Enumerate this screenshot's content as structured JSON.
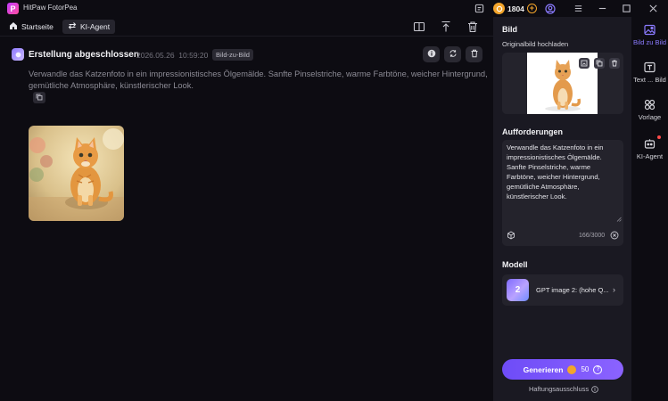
{
  "app": {
    "title": "HitPaw FotorPea",
    "logo_letter": "P",
    "accent": "#7b5cff",
    "coin_color": "#f3a52b"
  },
  "titlebar": {
    "coins": "1804",
    "icons": [
      "feedback-icon",
      "coin-icon",
      "add-coins-icon",
      "account-icon",
      "menu-icon",
      "minimize-icon",
      "maximize-icon",
      "close-icon"
    ]
  },
  "tabs": [
    {
      "label": "Startseite",
      "icon": "home-icon"
    },
    {
      "label": "KI-Agent",
      "icon": "swap-icon",
      "active": true
    }
  ],
  "main": {
    "header": {
      "title": "Erstellung abgeschlossen",
      "date": "2026.05.26",
      "time": "10:59:20",
      "badge": "Bild-zu-Bild"
    },
    "prompt": "Verwandle das Katzenfoto in ein impressionistisches Ölgemälde. Sanfte Pinselstriche, warme Farbtöne, weicher Hintergrund, gemütliche Atmosphäre, künstlerischer Look.",
    "action_icons": [
      "info-icon",
      "regenerate-icon",
      "delete-icon"
    ]
  },
  "panel": {
    "bild_title": "Bild",
    "upload_label": "Originalbild hochladen",
    "aufforderungen_title": "Aufforderungen",
    "prompt_text": "Verwandle das Katzenfoto in ein impressionistisches Ölgemälde. Sanfte Pinselstriche, warme Farbtöne, weicher Hintergrund, gemütliche Atmosphäre, künstlerischer Look.",
    "prompt_count": "166/3000",
    "modell_title": "Modell",
    "model_name": "GPT image 2: (hohe Q...",
    "model_thumb_text": "2",
    "generate_label": "Generieren",
    "generate_cost": "50",
    "disclaimer": "Haftungsausschluss"
  },
  "rail": [
    {
      "label": "Bild zu Bild",
      "icon": "image-icon",
      "active": true
    },
    {
      "label": "Text ... Bild",
      "icon": "text-to-image-icon"
    },
    {
      "label": "Vorlage",
      "icon": "templates-icon"
    },
    {
      "label": "KI-Agent",
      "icon": "ai-agent-icon",
      "notification": true
    }
  ]
}
